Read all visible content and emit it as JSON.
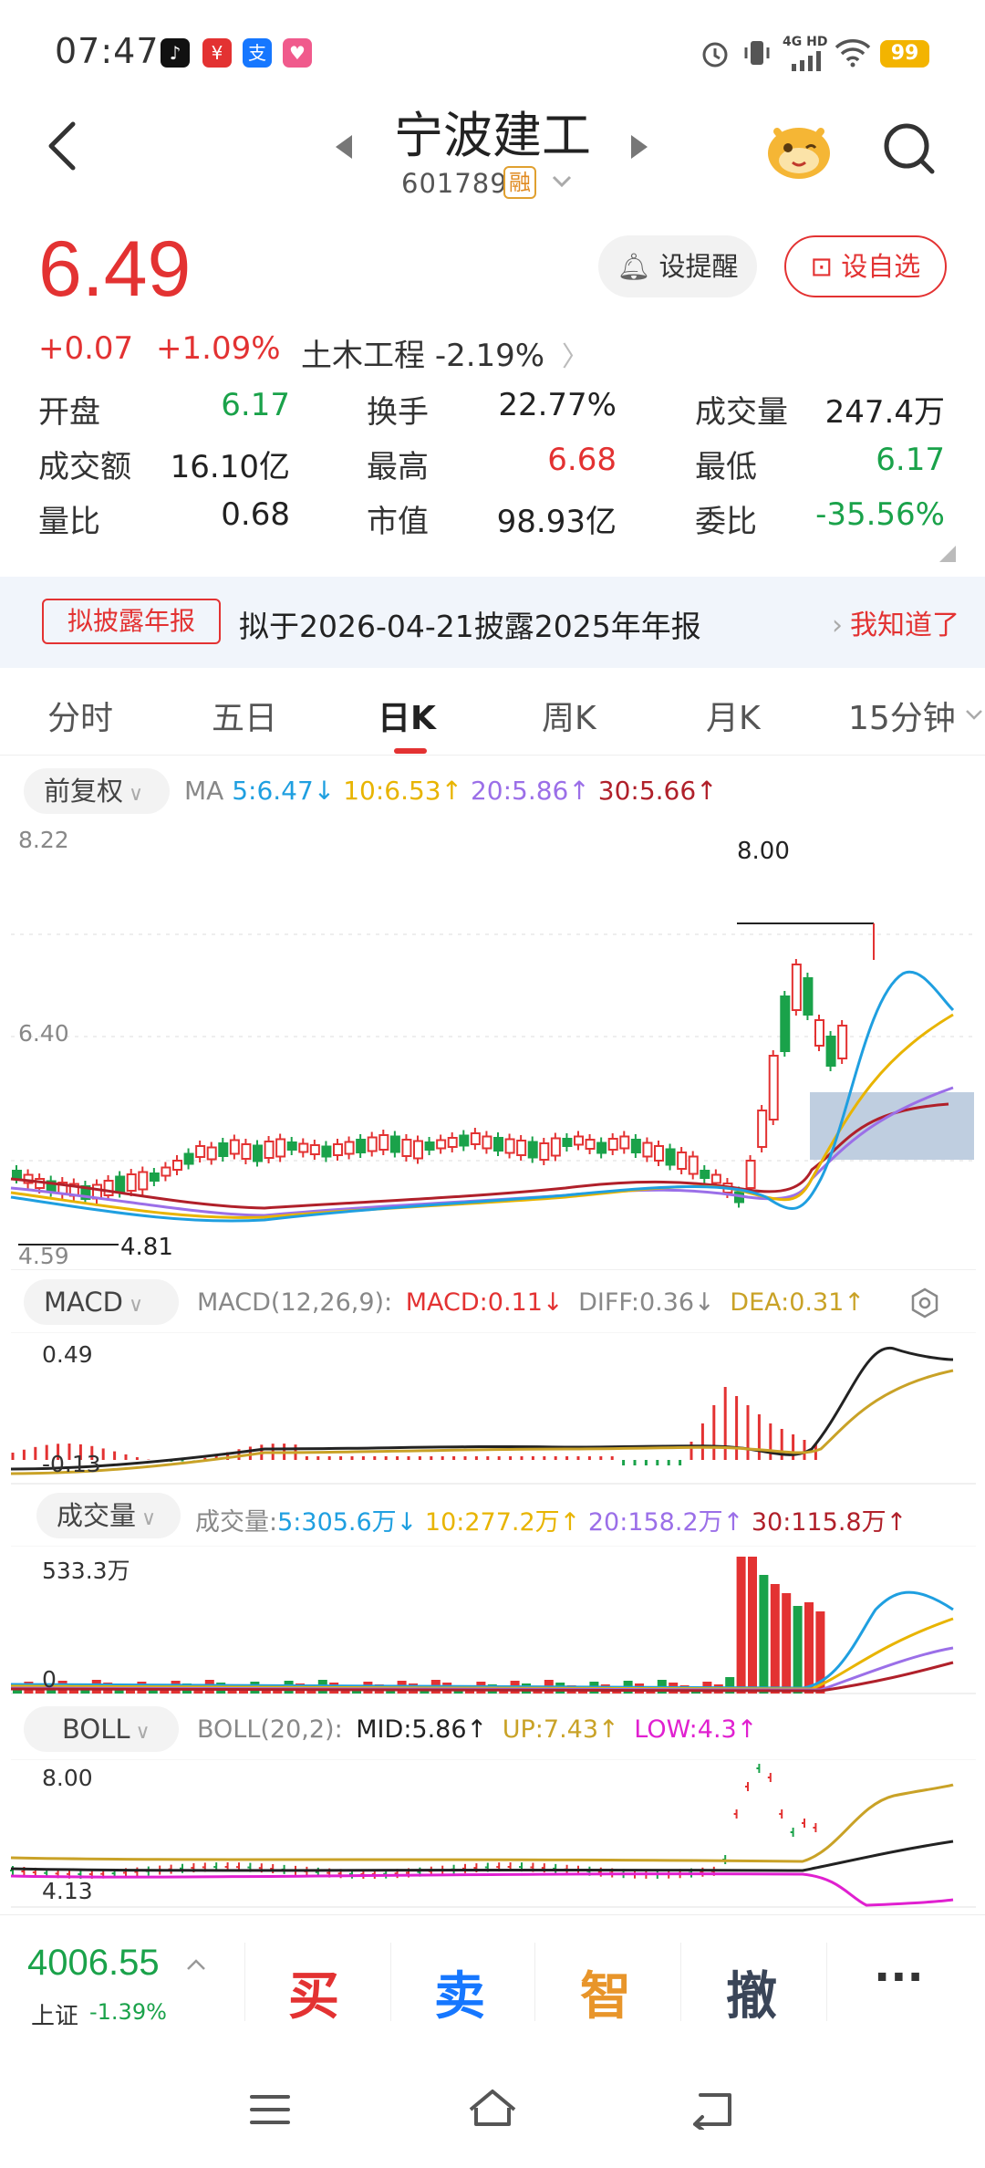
{
  "status_bar": {
    "time": "07:47",
    "network": "4G HD",
    "battery": "99"
  },
  "header": {
    "stock_name": "宁波建工",
    "stock_code": "601789",
    "margin_badge": "融"
  },
  "quote": {
    "price": "6.49",
    "change": "+0.07",
    "change_pct": "+1.09%",
    "sector": "土木工程",
    "sector_change": "-2.19%",
    "alert_label": "设提醒",
    "watch_label": "设自选"
  },
  "stats": [
    {
      "label": "开盘",
      "value": "6.17",
      "color": "green"
    },
    {
      "label": "换手",
      "value": "22.77%",
      "color": "black"
    },
    {
      "label": "成交量",
      "value": "247.4万",
      "color": "black"
    },
    {
      "label": "成交额",
      "value": "16.10亿",
      "color": "black"
    },
    {
      "label": "最高",
      "value": "6.68",
      "color": "red"
    },
    {
      "label": "最低",
      "value": "6.17",
      "color": "green"
    },
    {
      "label": "量比",
      "value": "0.68",
      "color": "black"
    },
    {
      "label": "市值",
      "value": "98.93亿",
      "color": "black"
    },
    {
      "label": "委比",
      "value": "-35.56%",
      "color": "green"
    }
  ],
  "notice": {
    "tag": "拟披露年报",
    "text": "拟于2026-04-21披露2025年年报",
    "ack": "我知道了"
  },
  "tabs": [
    "分时",
    "五日",
    "日K",
    "周K",
    "月K",
    "15分钟"
  ],
  "active_tab": "日K",
  "kline": {
    "adjust": "前复权",
    "ma_label": "MA",
    "ma": [
      {
        "text": "5:6.47↓",
        "color": "#1f9fe0"
      },
      {
        "text": "10:6.53↑",
        "color": "#e8b400"
      },
      {
        "text": "20:5.86↑",
        "color": "#9b6fe8"
      },
      {
        "text": "30:5.66↑",
        "color": "#b0202a"
      }
    ],
    "y_max": "8.22",
    "y_mid": "6.40",
    "y_min": "4.59",
    "high_mark": "8.00",
    "low_mark": "4.81"
  },
  "macd": {
    "label": "MACD",
    "params": "MACD(12,26,9):",
    "macd": "MACD:0.11↓",
    "diff": "DIFF:0.36↓",
    "dea": "DEA:0.31↑",
    "y_max": "0.49",
    "y_min": "-0.13"
  },
  "volume": {
    "label": "成交量",
    "prefix": "成交量:",
    "ma5": "5:305.6万↓",
    "ma10": "10:277.2万↑",
    "ma20": "20:158.2万↑",
    "ma30": "30:115.8万↑",
    "y_max": "533.3万",
    "y_min": "0"
  },
  "boll": {
    "label": "BOLL",
    "params": "BOLL(20,2):",
    "mid": "MID:5.86↑",
    "up": "UP:7.43↑",
    "low": "LOW:4.3↑",
    "y_max": "8.00",
    "y_min": "4.13"
  },
  "bottom": {
    "index_value": "4006.55",
    "index_name": "上证",
    "index_change": "-1.39%",
    "buy": "买",
    "sell": "卖",
    "smart": "智",
    "cancel": "撤",
    "more": "···"
  },
  "colors": {
    "up": "#e33232",
    "down": "#1aa24a"
  }
}
